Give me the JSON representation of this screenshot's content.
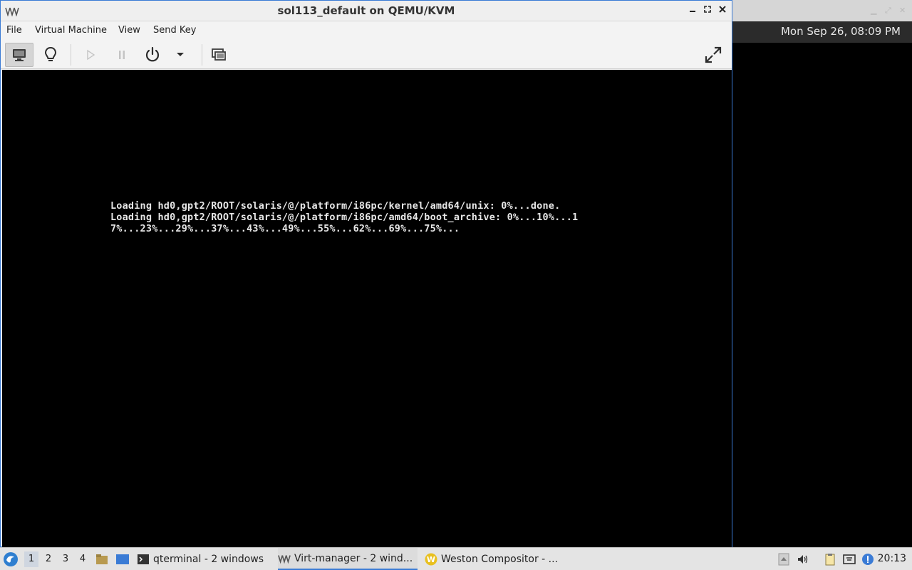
{
  "window": {
    "title": "sol113_default on QEMU/KVM"
  },
  "menubar": {
    "items": [
      "File",
      "Virtual Machine",
      "View",
      "Send Key"
    ]
  },
  "toolbar": {
    "icons": [
      "console-view-icon",
      "details-lightbulb-icon",
      "run-icon",
      "pause-icon",
      "power-icon",
      "power-dropdown-icon",
      "snapshots-icon",
      "fullscreen-icon"
    ]
  },
  "console": {
    "lines": [
      "Loading hd0,gpt2/ROOT/solaris/@/platform/i86pc/kernel/amd64/unix: 0%...done.",
      "Loading hd0,gpt2/ROOT/solaris/@/platform/i86pc/amd64/boot_archive: 0%...10%...1",
      "7%...23%...29%...37%...43%...49%...55%...62%...69%...75%..."
    ]
  },
  "background_panel": {
    "clock": "Mon Sep 26, 08:09 PM"
  },
  "taskbar": {
    "workspaces": [
      "1",
      "2",
      "3",
      "4"
    ],
    "active_workspace": "1",
    "tasks": [
      {
        "label": "qterminal - 2 windows",
        "icon": "terminal-icon"
      },
      {
        "label": "Virt-manager - 2 wind...",
        "icon": "virt-manager-icon"
      },
      {
        "label": "Weston Compositor - ...",
        "icon": "weston-icon"
      }
    ],
    "clock": "20:13"
  },
  "colors": {
    "accent": "#3a7bd5",
    "console_bg": "#000000",
    "console_text": "#e6e6e6"
  }
}
